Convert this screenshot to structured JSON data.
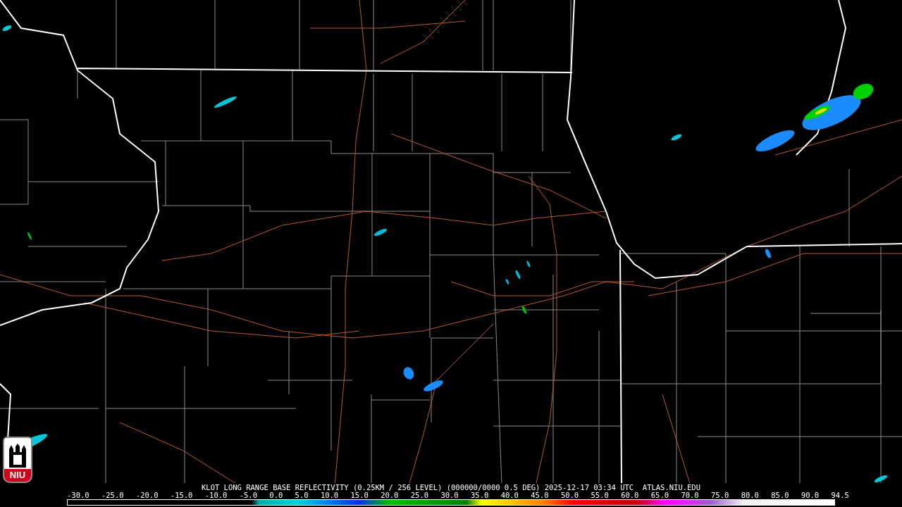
{
  "map": {
    "caption": "KLOT LONG RANGE BASE REFLECTIVITY (0.25KM / 256 LEVEL) (000000/0000 0.5 DEG) 2025-12-17 03:34 UTC  ATLAS.NIU.EDU"
  },
  "logo": {
    "text": "NIU"
  },
  "legend": {
    "ticks": [
      "-30.0",
      "-25.0",
      "-20.0",
      "-15.0",
      "-10.0",
      "-5.0",
      "0.0",
      "5.0",
      "10.0",
      "15.0",
      "20.0",
      "25.0",
      "30.0",
      "35.0",
      "40.0",
      "45.0",
      "50.0",
      "55.0",
      "60.0",
      "65.0",
      "70.0",
      "75.0",
      "80.0",
      "85.0",
      "90.0",
      "94.5"
    ]
  }
}
